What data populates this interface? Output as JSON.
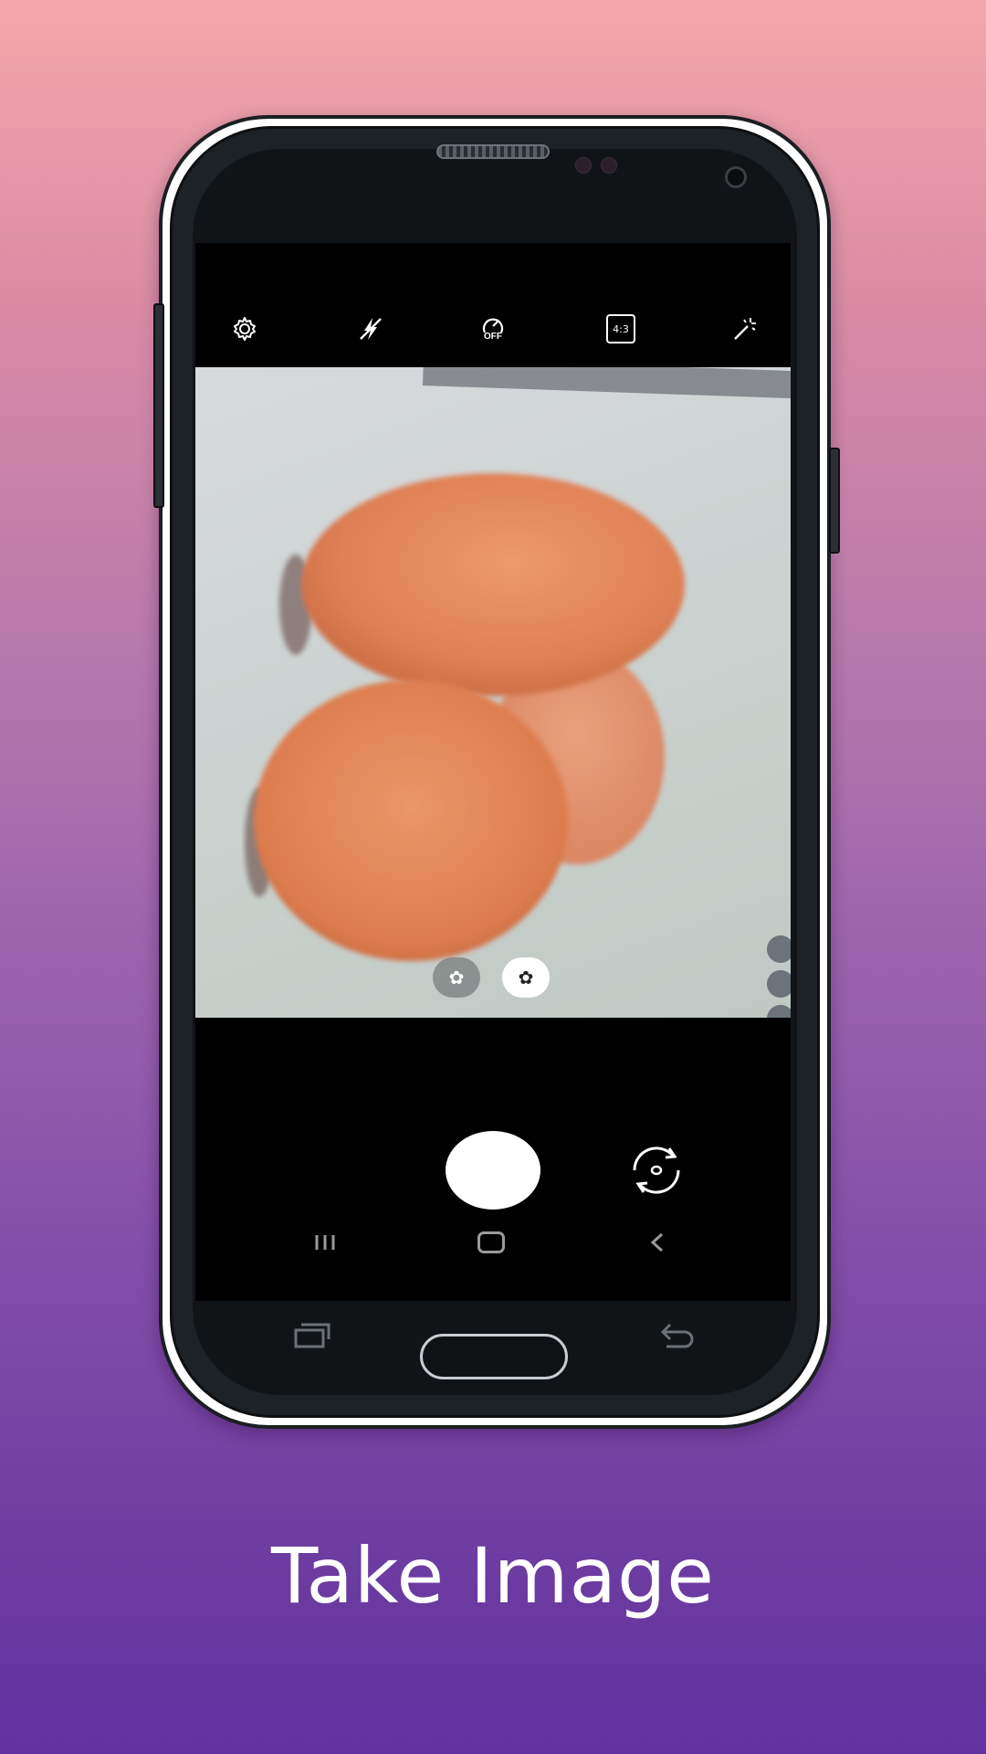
{
  "caption": "Take Image",
  "toolbar": {
    "icons": [
      "settings-icon",
      "flash-off-icon",
      "timer-off-icon",
      "aspect-ratio-icon",
      "filter-effects-icon"
    ],
    "aspect_ratio_label": "4:3",
    "timer_label": "OFF"
  },
  "viewfinder": {
    "scene_toggles": [
      "scene-optimizer-off-icon",
      "scene-optimizer-on-icon"
    ]
  },
  "controls": {
    "shutter": "shutter-button",
    "switch_camera": "switch-camera-icon"
  },
  "navigation": [
    "recent-apps-icon",
    "home-icon",
    "back-icon"
  ],
  "colors": {
    "background_top": "#f2a8aa",
    "background_bottom": "#6232a0",
    "caption_text": "#ffffff",
    "screen": "#000000",
    "egg": "#e38456"
  }
}
